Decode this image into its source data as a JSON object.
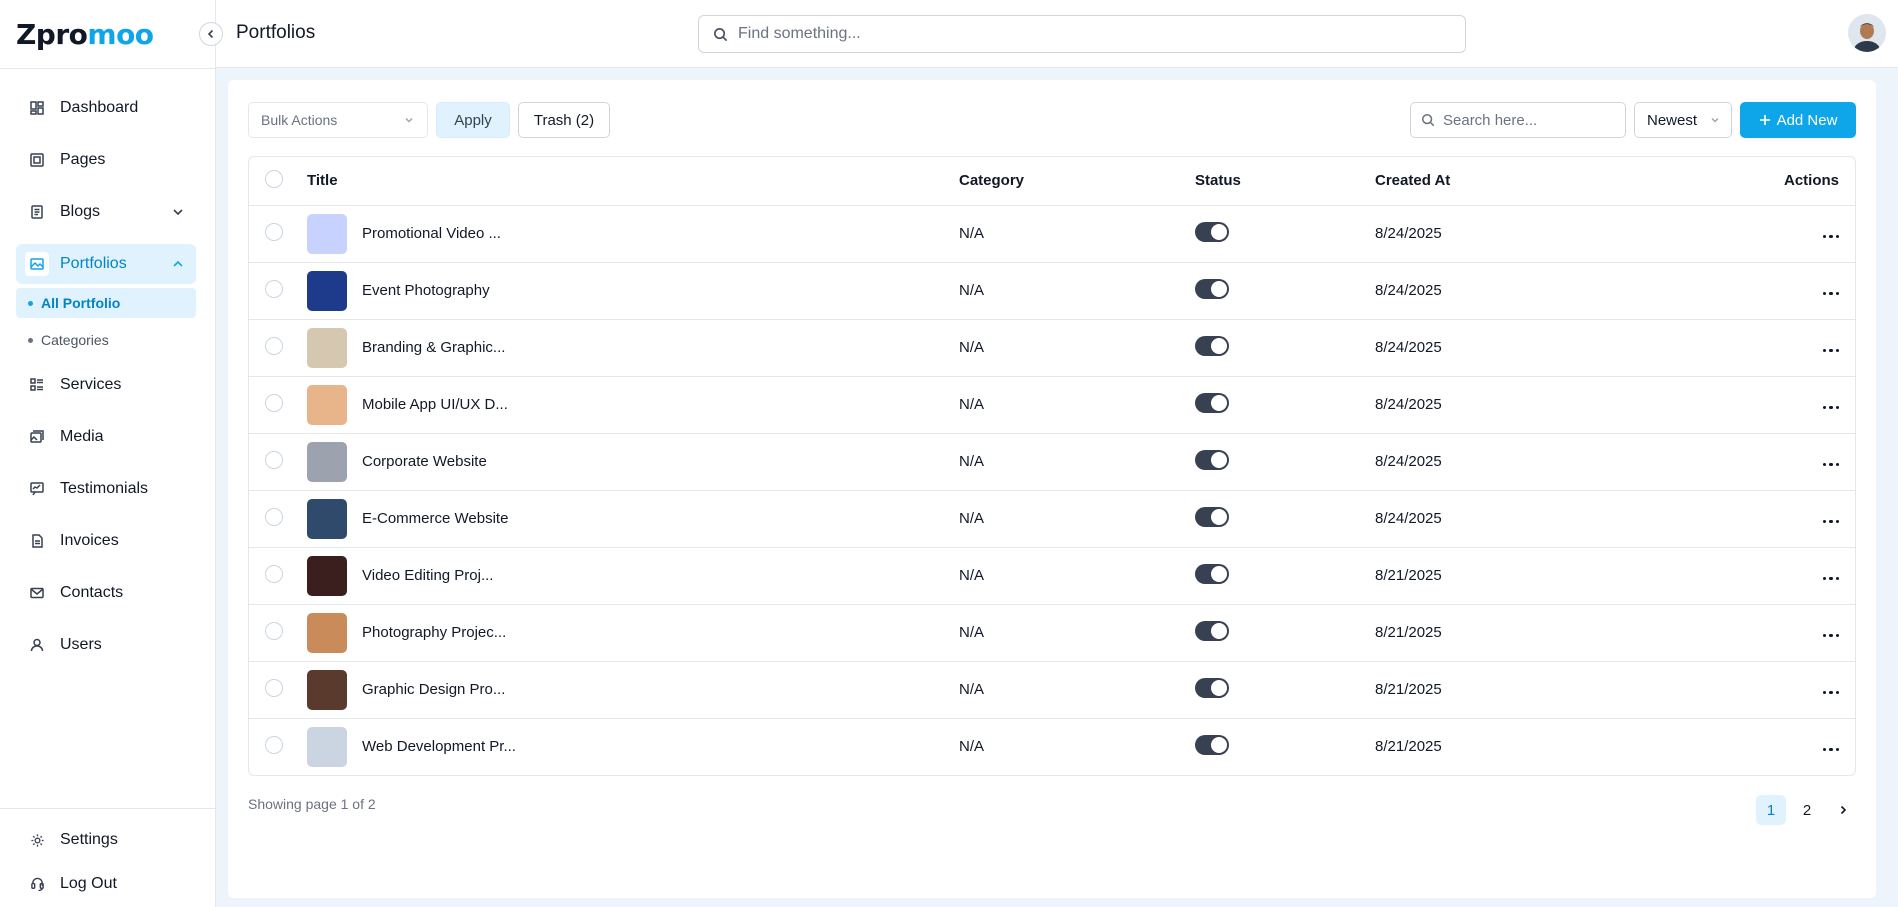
{
  "brand": {
    "logo_main": "Zpro",
    "logo_accent": "moo"
  },
  "header": {
    "title": "Portfolios",
    "search_placeholder": "Find something..."
  },
  "sidebar": {
    "items": [
      {
        "label": "Dashboard",
        "icon": "dashboard-icon"
      },
      {
        "label": "Pages",
        "icon": "pages-icon"
      },
      {
        "label": "Blogs",
        "icon": "blogs-icon",
        "has_submenu": true
      },
      {
        "label": "Portfolios",
        "icon": "portfolio-icon",
        "active": true,
        "expanded": true
      },
      {
        "label": "Services",
        "icon": "services-icon"
      },
      {
        "label": "Media",
        "icon": "media-icon"
      },
      {
        "label": "Testimonials",
        "icon": "testimonials-icon"
      },
      {
        "label": "Invoices",
        "icon": "invoice-icon"
      },
      {
        "label": "Contacts",
        "icon": "mail-icon"
      },
      {
        "label": "Users",
        "icon": "user-icon"
      }
    ],
    "subitems": [
      {
        "label": "All Portfolio",
        "active": true
      },
      {
        "label": "Categories"
      }
    ],
    "bottom": [
      {
        "label": "Settings",
        "icon": "gear-icon"
      },
      {
        "label": "Log Out",
        "icon": "logout-icon"
      }
    ]
  },
  "toolbar": {
    "bulk_actions": "Bulk Actions",
    "apply": "Apply",
    "trash": "Trash (2)",
    "search_placeholder": "Search here...",
    "sort": "Newest",
    "add_new": "Add New"
  },
  "table": {
    "columns": [
      "Title",
      "Category",
      "Status",
      "Created At",
      "Actions"
    ],
    "rows": [
      {
        "title": "Promotional Video ...",
        "category": "N/A",
        "status": true,
        "created": "8/24/2025",
        "thumb": "#c7d2fe"
      },
      {
        "title": "Event Photography",
        "category": "N/A",
        "status": true,
        "created": "8/24/2025",
        "thumb": "#1e3a8a"
      },
      {
        "title": "Branding & Graphic...",
        "category": "N/A",
        "status": true,
        "created": "8/24/2025",
        "thumb": "#d6c7b0"
      },
      {
        "title": "Mobile App UI/UX D...",
        "category": "N/A",
        "status": true,
        "created": "8/24/2025",
        "thumb": "#e8b48a"
      },
      {
        "title": "Corporate Website",
        "category": "N/A",
        "status": true,
        "created": "8/24/2025",
        "thumb": "#9ca3af"
      },
      {
        "title": "E-Commerce Website",
        "category": "N/A",
        "status": true,
        "created": "8/24/2025",
        "thumb": "#2f4a6b"
      },
      {
        "title": "Video Editing Proj...",
        "category": "N/A",
        "status": true,
        "created": "8/21/2025",
        "thumb": "#3b1f1f"
      },
      {
        "title": "Photography Projec...",
        "category": "N/A",
        "status": true,
        "created": "8/21/2025",
        "thumb": "#c98b5a"
      },
      {
        "title": "Graphic Design Pro...",
        "category": "N/A",
        "status": true,
        "created": "8/21/2025",
        "thumb": "#5b3a2e"
      },
      {
        "title": "Web Development Pr...",
        "category": "N/A",
        "status": true,
        "created": "8/21/2025",
        "thumb": "#cbd5e1"
      }
    ]
  },
  "footer": {
    "page_info": "Showing page 1 of 2",
    "pages": [
      "1",
      "2"
    ],
    "current_page": "1"
  },
  "colors": {
    "accent": "#0ea5e9",
    "accent_light": "#e0f2fe",
    "toggle_on": "#374151"
  }
}
